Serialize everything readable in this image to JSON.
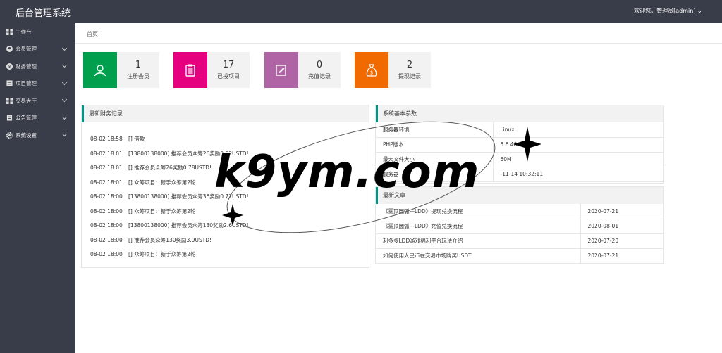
{
  "header": {
    "title": "后台管理系统",
    "welcome": "欢迎您，管理员[admin]"
  },
  "sidebar": {
    "items": [
      {
        "label": "工作台",
        "icon": "dashboard-icon",
        "has_arrow": false
      },
      {
        "label": "会员管理",
        "icon": "user-icon",
        "has_arrow": true
      },
      {
        "label": "财务管理",
        "icon": "money-icon",
        "has_arrow": true
      },
      {
        "label": "项目管理",
        "icon": "project-icon",
        "has_arrow": true
      },
      {
        "label": "交易大厅",
        "icon": "trade-icon",
        "has_arrow": true
      },
      {
        "label": "公告管理",
        "icon": "notice-icon",
        "has_arrow": true
      },
      {
        "label": "系统设置",
        "icon": "settings-icon",
        "has_arrow": true
      }
    ]
  },
  "breadcrumb": "首页",
  "stats": [
    {
      "value": "1",
      "label": "注册会员",
      "color": "#009f4d",
      "icon": "user-icon"
    },
    {
      "value": "17",
      "label": "已投项目",
      "color": "#e4007f",
      "icon": "clipboard-icon"
    },
    {
      "value": "0",
      "label": "充值记录",
      "color": "#b164a5",
      "icon": "edit-icon"
    },
    {
      "value": "2",
      "label": "提现记录",
      "color": "#f06a00",
      "icon": "money-bag-icon"
    }
  ],
  "finance": {
    "title": "最新财务记录",
    "records": [
      {
        "time": "08-02 18:58",
        "text": "[] 借款"
      },
      {
        "time": "08-02 18:01",
        "text": "[13800138000] 推荐会员众筹26奖励0.52USTD!"
      },
      {
        "time": "08-02 18:01",
        "text": "[] 推荐会员众筹26奖励0.78USTD!"
      },
      {
        "time": "08-02 18:01",
        "text": "[] 众筹项目：新手众筹第2轮"
      },
      {
        "time": "08-02 18:00",
        "text": "[13800138000] 推荐会员众筹36奖励0.72USTD!"
      },
      {
        "time": "08-02 18:00",
        "text": "[] 众筹项目：新手众筹第2轮"
      },
      {
        "time": "08-02 18:00",
        "text": "[13800138000] 推荐会员众筹130奖励2.6USTD!"
      },
      {
        "time": "08-02 18:00",
        "text": "[] 推荐会员众筹130奖励3.9USTD!"
      },
      {
        "time": "08-02 18:00",
        "text": "[] 众筹项目：新手众筹第2轮"
      }
    ]
  },
  "system": {
    "title": "系统基本参数",
    "rows": [
      {
        "key": "服务器环境",
        "value": "Linux"
      },
      {
        "key": "PHP版本",
        "value": "5.6.40"
      },
      {
        "key": "最大文件大小",
        "value": "50M"
      },
      {
        "key": "服务器",
        "value": "-11-14 10:32:11"
      }
    ]
  },
  "articles": {
    "title": "最新文章",
    "rows": [
      {
        "title": "《雾顶圆弧—LDD》提现兑换流程",
        "date": "2020-07-21"
      },
      {
        "title": "《雾顶圆弧—LDD》充值兑换流程",
        "date": "2020-08-01"
      },
      {
        "title": "利多多LDD游戏福利平台玩法介绍",
        "date": "2020-07-20"
      },
      {
        "title": "如何使用人民币在交易市场购买USDT",
        "date": "2020-07-21"
      }
    ]
  },
  "watermark": "k9ym.com"
}
